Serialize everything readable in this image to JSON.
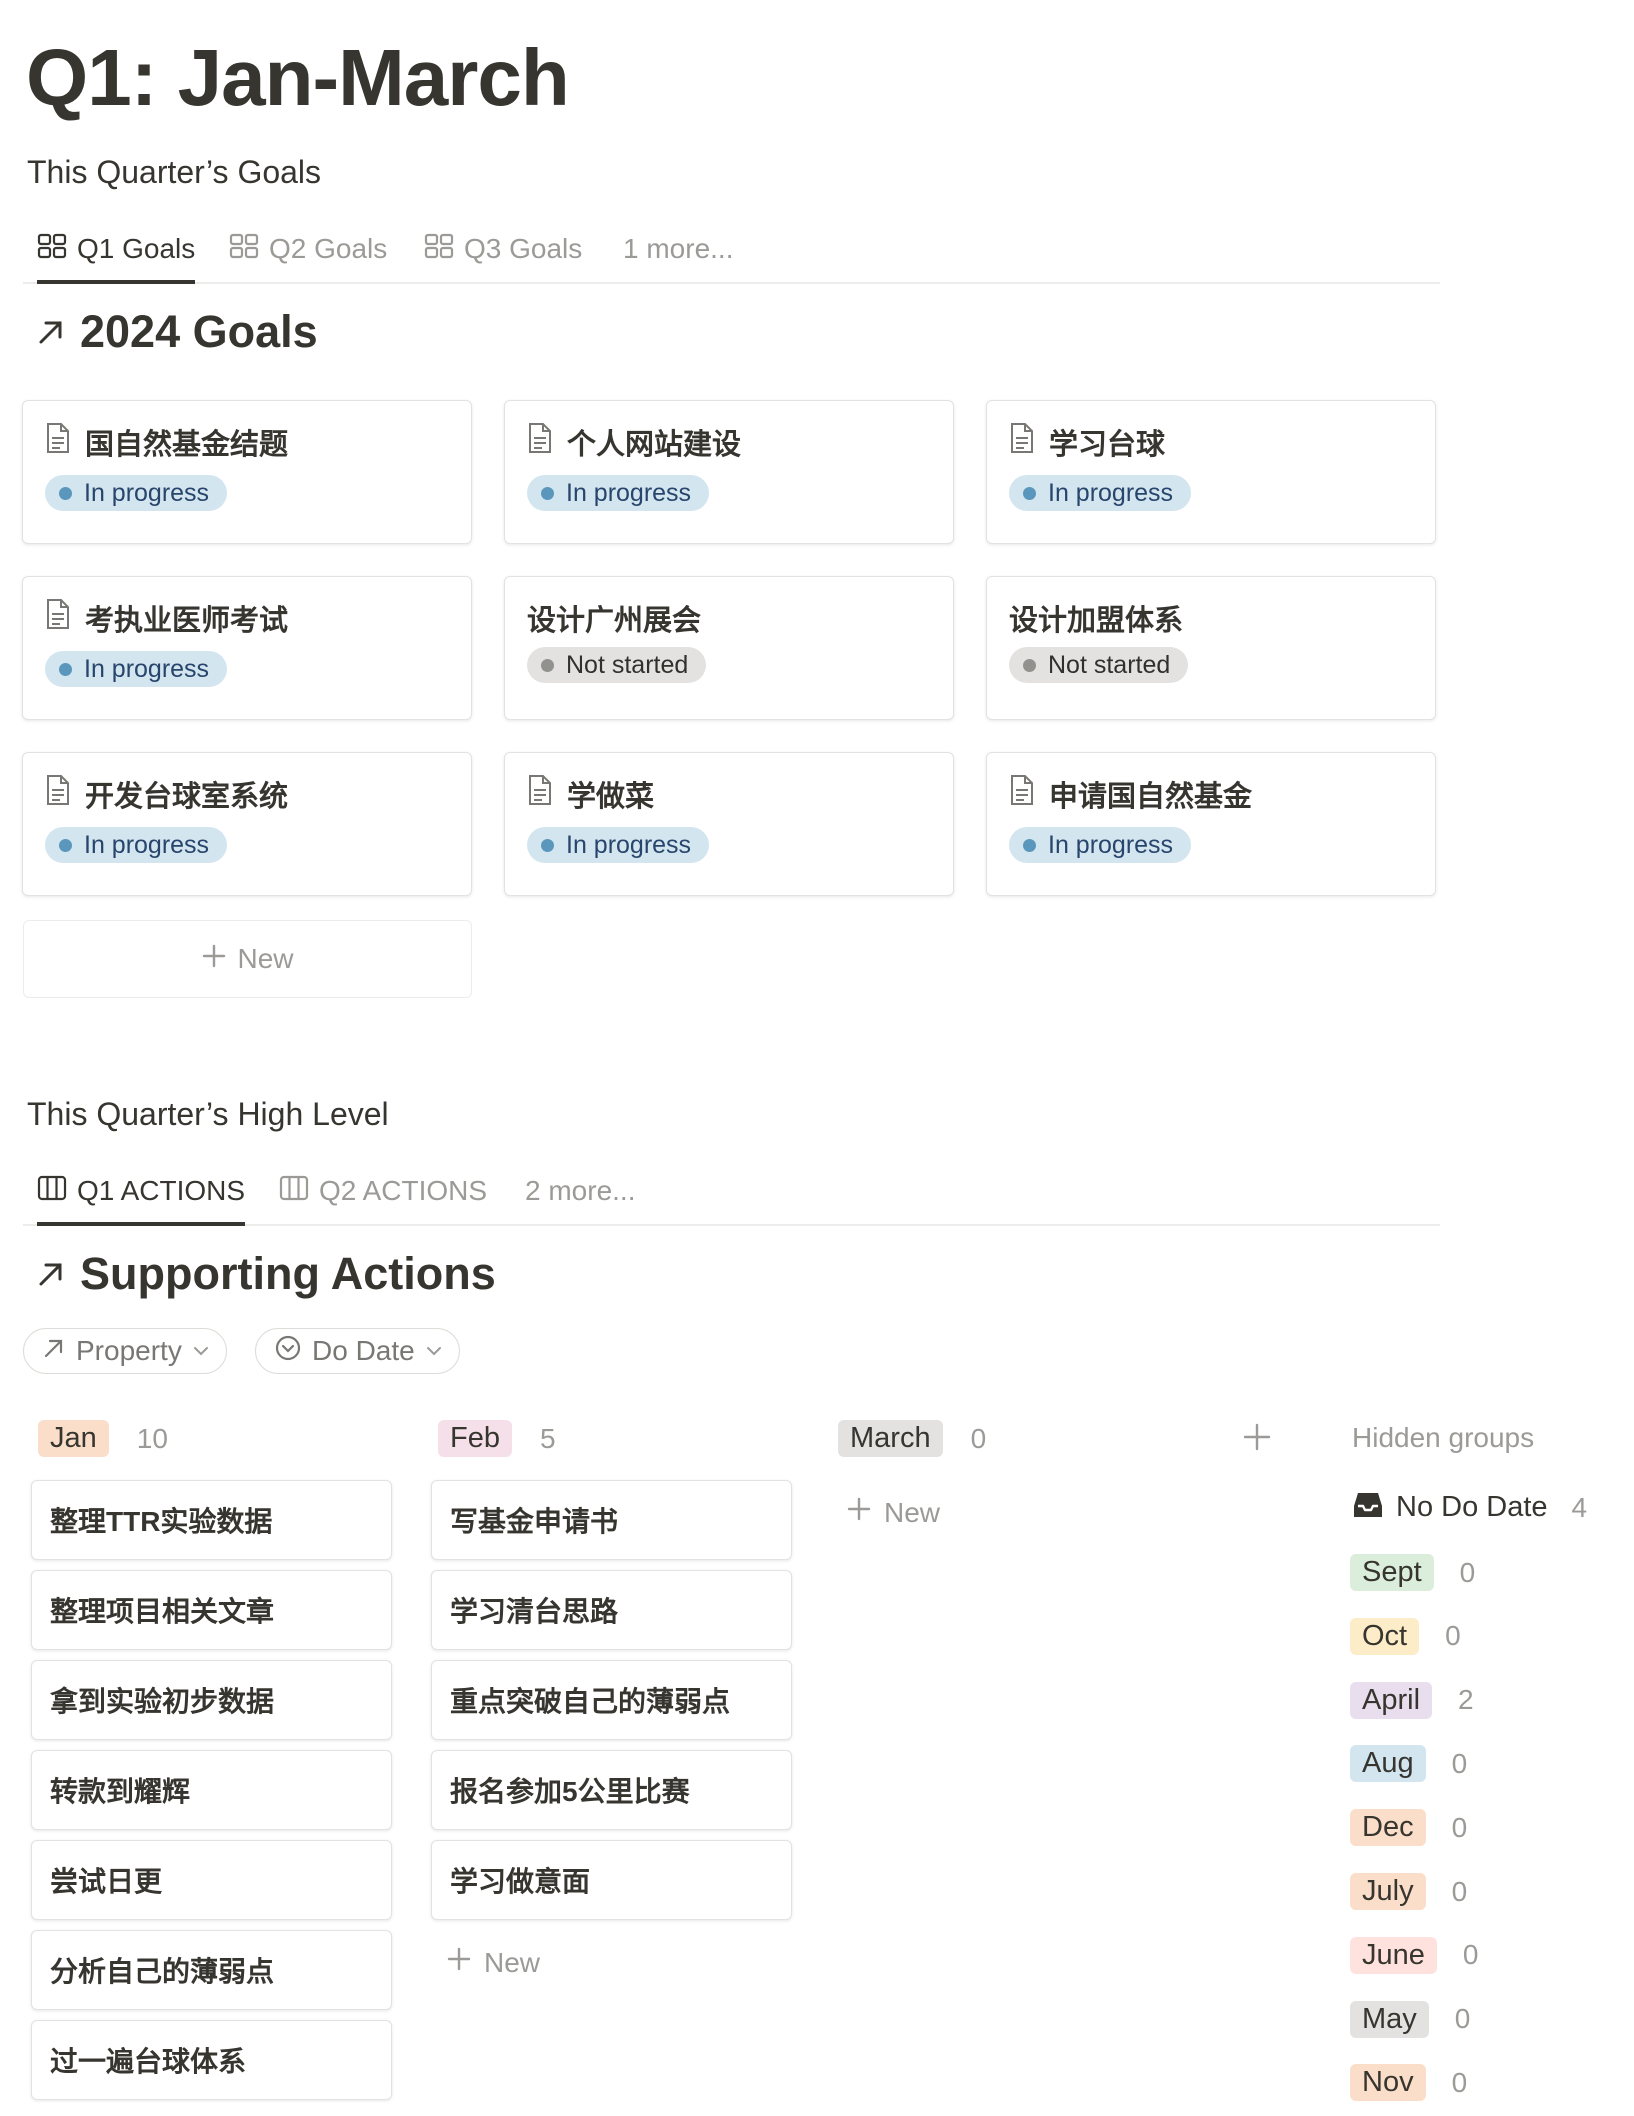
{
  "page": {
    "title": "Q1: Jan-March"
  },
  "goals_section": {
    "heading": "This Quarter’s Goals",
    "tabs": [
      {
        "label": "Q1 Goals",
        "icon": "gallery-icon"
      },
      {
        "label": "Q2 Goals",
        "icon": "gallery-icon"
      },
      {
        "label": "Q3 Goals",
        "icon": "gallery-icon"
      },
      {
        "label": "1 more..."
      }
    ],
    "db_title": "2024 Goals",
    "cards": [
      {
        "title": "国自然基金结题",
        "status": "In progress"
      },
      {
        "title": "个人网站建设",
        "status": "In progress"
      },
      {
        "title": "学习台球",
        "status": "In progress"
      },
      {
        "title": "考执业医师考试",
        "status": "In progress"
      },
      {
        "title": "设计广州展会",
        "status": "Not started"
      },
      {
        "title": "设计加盟体系",
        "status": "Not started"
      },
      {
        "title": "开发台球室系统",
        "status": "In progress"
      },
      {
        "title": "学做菜",
        "status": "In progress"
      },
      {
        "title": "申请国自然基金",
        "status": "In progress"
      }
    ],
    "new_label": "New"
  },
  "actions_section": {
    "heading": "This Quarter’s High Level",
    "tabs": [
      {
        "label": "Q1 ACTIONS",
        "icon": "board-icon"
      },
      {
        "label": "Q2 ACTIONS",
        "icon": "board-icon"
      },
      {
        "label": "2 more..."
      }
    ],
    "db_title": "Supporting Actions",
    "filters": [
      {
        "label": "Property",
        "icon": "arrow-up-right-icon"
      },
      {
        "label": "Do Date",
        "icon": "chevron-circle-icon"
      }
    ],
    "columns": [
      {
        "name": "Jan",
        "count": "10",
        "color": "#fadec9",
        "items": [
          "整理TTR实验数据",
          "整理项目相关文章",
          "拿到实验初步数据",
          "转款到耀辉",
          "尝试日更",
          "分析自己的薄弱点",
          "过一遍台球体系"
        ]
      },
      {
        "name": "Feb",
        "count": "5",
        "color": "#f5e0e9",
        "items": [
          "写基金申请书",
          "学习清台思路",
          "重点突破自己的薄弱点",
          "报名参加5公里比赛",
          "学习做意面"
        ]
      },
      {
        "name": "March",
        "count": "0",
        "color": "#e3e2e0",
        "items": []
      }
    ],
    "new_label": "New",
    "hidden_groups": {
      "title": "Hidden groups",
      "no_date": {
        "label": "No Do Date",
        "count": "4"
      },
      "groups": [
        {
          "name": "Sept",
          "count": "0",
          "color": "#dbeddb"
        },
        {
          "name": "Oct",
          "count": "0",
          "color": "#fdecc8"
        },
        {
          "name": "April",
          "count": "2",
          "color": "#e8deee"
        },
        {
          "name": "Aug",
          "count": "0",
          "color": "#d3e5ef"
        },
        {
          "name": "Dec",
          "count": "0",
          "color": "#fadec9"
        },
        {
          "name": "July",
          "count": "0",
          "color": "#fadec9"
        },
        {
          "name": "June",
          "count": "0",
          "color": "#ffe2dd"
        },
        {
          "name": "May",
          "count": "0",
          "color": "#e3e2e0"
        },
        {
          "name": "Nov",
          "count": "0",
          "color": "#fadec9"
        }
      ]
    }
  }
}
